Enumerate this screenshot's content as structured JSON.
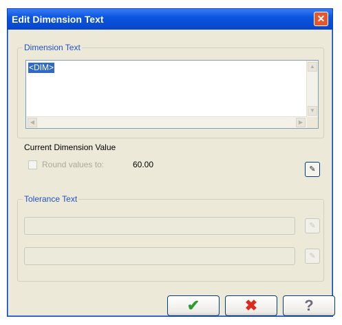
{
  "window": {
    "title": "Edit Dimension Text",
    "close_glyph": "✕"
  },
  "dimension_text": {
    "group_label": "Dimension Text",
    "value": "<DIM>"
  },
  "current_value": {
    "label": "Current Dimension Value",
    "checkbox_label": "Round values to:",
    "value": "60.00",
    "button_icon": "edit-icon"
  },
  "tolerance": {
    "group_label": "Tolerance Text",
    "field1_value": "",
    "field2_value": "",
    "button_icon": "edit-icon"
  },
  "buttons": {
    "ok_icon": "checkmark-icon",
    "cancel_icon": "x-icon",
    "help_icon": "question-icon"
  },
  "colors": {
    "title_bar": "#0a55e0",
    "ok_green": "#2f9a2f",
    "cancel_red": "#d92b1f",
    "group_label": "#1e50c8"
  }
}
